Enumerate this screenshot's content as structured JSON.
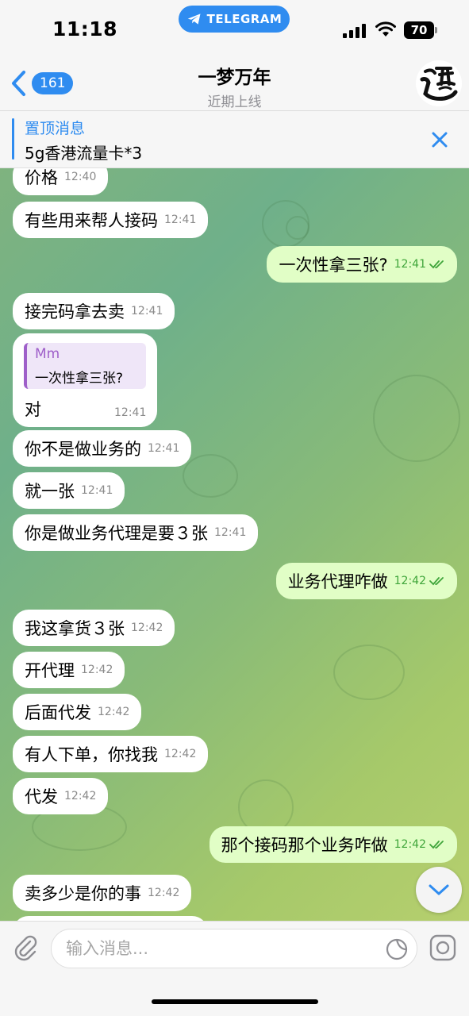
{
  "status": {
    "time": "11:18",
    "app_pill": "TELEGRAM",
    "battery": "70"
  },
  "header": {
    "back_count": "161",
    "title": "一梦万年",
    "subtitle": "近期上线",
    "avatar_icon": "calligraphy-avatar"
  },
  "pinned": {
    "label": "置顶消息",
    "text": "5g香港流量卡*3"
  },
  "messages": [
    {
      "text": "价格",
      "time": "12:40"
    },
    {
      "text": "有些用来帮人接码",
      "time": "12:41"
    },
    {
      "text": "一次性拿三张?",
      "time": "12:41"
    },
    {
      "text": "接完码拿去卖",
      "time": "12:41"
    },
    {
      "reply_name": "Mm",
      "reply_text": "一次性拿三张?",
      "text": "对",
      "time": "12:41"
    },
    {
      "text": "你不是做业务的",
      "time": "12:41"
    },
    {
      "text": "就一张",
      "time": "12:41"
    },
    {
      "text": "你是做业务代理是要３张",
      "time": "12:41"
    },
    {
      "text": "业务代理咋做",
      "time": "12:42"
    },
    {
      "text": "我这拿货３张",
      "time": "12:42"
    },
    {
      "text": "开代理",
      "time": "12:42"
    },
    {
      "text": "后面代发",
      "time": "12:42"
    },
    {
      "text": "有人下单，你找我",
      "time": "12:42"
    },
    {
      "text": "代发",
      "time": "12:42"
    },
    {
      "text": "那个接码那个业务咋做",
      "time": "12:42"
    },
    {
      "text": "卖多少是你的事",
      "time": "12:42"
    }
  ],
  "input": {
    "placeholder": "输入消息..."
  },
  "colors": {
    "accent": "#2f8cf0",
    "outgoing_bubble": "#e1fec6",
    "read_ticks": "#3fa53a",
    "reply_accent": "#9e5fc9"
  }
}
